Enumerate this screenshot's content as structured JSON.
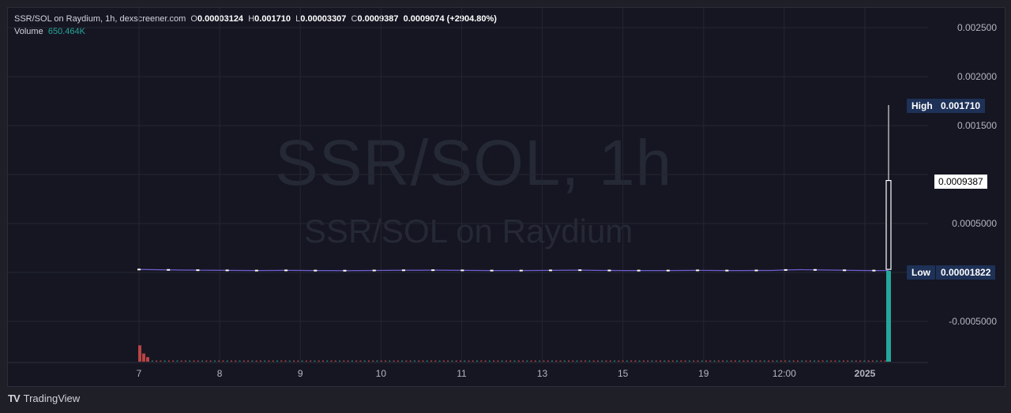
{
  "legend": {
    "pair": "SSR/SOL on Raydium, 1h, dexscreener.com",
    "o_label": "O",
    "o_value": "0.00003124",
    "h_label": "H",
    "h_value": "0.001710",
    "l_label": "L",
    "l_value": "0.00003307",
    "c_label": "C",
    "c_value": "0.0009387",
    "change": "0.0009074 (+2904.80%)",
    "volume_label": "Volume",
    "volume_value": "650.464K"
  },
  "watermark": {
    "main": "SSR/SOL, 1h",
    "sub": "SSR/SOL on Raydium"
  },
  "markers": {
    "high_label": "High",
    "high_value": "0.001710",
    "current_value": "0.0009387",
    "low_label": "Low",
    "low_value": "0.00001822"
  },
  "branding": {
    "logo_mark": "TV",
    "name": "TradingView"
  },
  "colors": {
    "background": "#151622",
    "grid": "#23262f",
    "up": "#26a69a",
    "down": "#ef5350",
    "price_line": "#6f5fd3",
    "candle": "#ffffff",
    "marker_bg": "#1e3157"
  },
  "chart_data": {
    "type": "candlestick",
    "title": "SSR/SOL on Raydium, 1h, dexscreener.com",
    "y_ticks": [
      0.0025,
      0.002,
      0.0015,
      0.001,
      0.0005,
      0,
      -0.0005
    ],
    "y_tick_labels": [
      "0.002500",
      "0.002000",
      "0.001500",
      "",
      "0.0005000",
      "",
      "-0.0005000"
    ],
    "ylim": [
      -0.00083,
      0.00262
    ],
    "x_ticks": [
      {
        "label": "7",
        "pos": 0.0
      },
      {
        "label": "8",
        "pos": 0.1
      },
      {
        "label": "9",
        "pos": 0.2
      },
      {
        "label": "10",
        "pos": 0.3
      },
      {
        "label": "11",
        "pos": 0.4
      },
      {
        "label": "13",
        "pos": 0.5
      },
      {
        "label": "15",
        "pos": 0.6
      },
      {
        "label": "19",
        "pos": 0.7
      },
      {
        "label": "12:00",
        "pos": 0.8
      },
      {
        "label": "2025",
        "pos": 0.9
      }
    ],
    "series": [
      {
        "name": "price",
        "baseline_values": [
          3e-05,
          2.8e-05,
          2.6e-05,
          2.4e-05,
          2.3e-05,
          2.2e-05,
          2.1e-05,
          2e-05,
          1.9e-05,
          2e-05,
          2.1e-05,
          2e-05,
          1.9e-05,
          1.9e-05,
          1.8e-05,
          1.9e-05,
          2e-05,
          2.1e-05,
          2.2e-05,
          2.2e-05,
          2.3e-05,
          2.2e-05,
          2.1e-05,
          2e-05,
          1.9e-05,
          1.9e-05,
          1.9e-05,
          2e-05,
          2.1e-05,
          2.2e-05,
          2.3e-05,
          2.1e-05,
          2e-05,
          1.9e-05,
          1.9e-05,
          1.9e-05,
          1.9e-05,
          2e-05,
          2.1e-05,
          2e-05,
          1.9e-05,
          1.9e-05,
          2e-05,
          2e-05,
          2.5e-05,
          2.8e-05,
          2.6e-05,
          2.4e-05,
          2.2e-05,
          2e-05,
          1.9e-05,
          1.9e-05
        ],
        "last_candle": {
          "open": 3.124e-05,
          "high": 0.00171,
          "low": 3.307e-05,
          "close": 0.0009387
        }
      }
    ],
    "volume": {
      "label": "Volume",
      "early_spike": [
        0.18,
        0.09,
        0.05
      ],
      "last_bar": 1.0
    }
  }
}
